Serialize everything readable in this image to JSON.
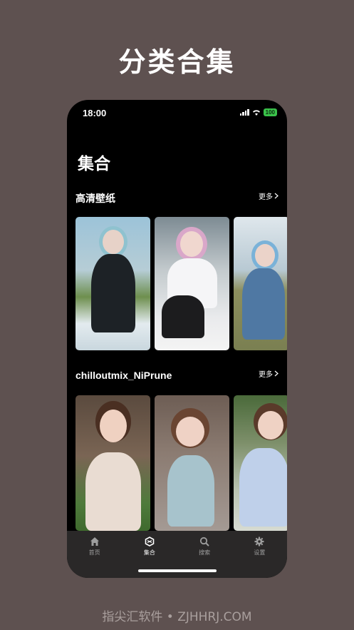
{
  "promo_title": "分类合集",
  "status_bar": {
    "time": "18:00",
    "battery": "100"
  },
  "page_heading": "集合",
  "sections": [
    {
      "title": "高清壁纸",
      "more": "更多"
    },
    {
      "title": "chilloutmix_NiPrune",
      "more": "更多"
    }
  ],
  "tabs": [
    {
      "label": "首页",
      "icon": "home-icon"
    },
    {
      "label": "集合",
      "icon": "collection-icon"
    },
    {
      "label": "搜索",
      "icon": "search-icon"
    },
    {
      "label": "设置",
      "icon": "gear-icon"
    }
  ],
  "active_tab": "集合",
  "watermark": "指尖汇软件 • ZJHHRJ.COM",
  "colors": {
    "background": "#5e5150",
    "phone": "#000000",
    "tab_bar": "#2a2828",
    "battery": "#3ac24a"
  }
}
